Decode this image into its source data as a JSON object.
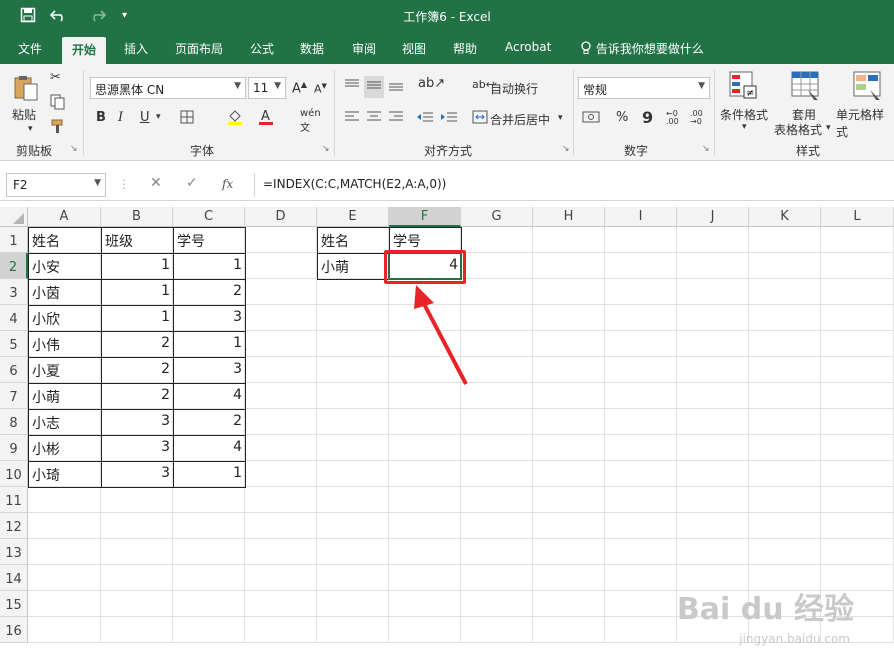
{
  "titlebar": {
    "title": "工作簿6  -  Excel",
    "save_icon": "save-icon",
    "undo_icon": "undo-icon",
    "redo_icon": "redo-icon"
  },
  "tabs": [
    "文件",
    "开始",
    "插入",
    "页面布局",
    "公式",
    "数据",
    "审阅",
    "视图",
    "帮助",
    "Acrobat"
  ],
  "active_tab": "开始",
  "tell_me": "告诉我你想要做什么",
  "ribbon": {
    "clipboard": {
      "paste": "粘贴",
      "label": "剪贴板"
    },
    "font": {
      "name": "思源黑体 CN",
      "size": "11",
      "bold": "B",
      "italic": "I",
      "underline": "U",
      "label": "字体"
    },
    "alignment": {
      "wrap": "自动换行",
      "merge": "合并后居中",
      "label": "对齐方式"
    },
    "number": {
      "format": "常规",
      "percent": "%",
      "comma": "9",
      "label": "数字"
    },
    "styles": {
      "conditional": "条件格式",
      "table1": "套用",
      "table2": "表格格式",
      "cell_styles": "单元格样式",
      "label": "样式"
    }
  },
  "formula_bar": {
    "name_box": "F2",
    "fx": "fx",
    "formula": "=INDEX(C:C,MATCH(E2,A:A,0))"
  },
  "columns": [
    "A",
    "B",
    "C",
    "D",
    "E",
    "F",
    "G",
    "H",
    "I",
    "J",
    "K",
    "L"
  ],
  "rows": [
    "1",
    "2",
    "3",
    "4",
    "5",
    "6",
    "7",
    "8",
    "9",
    "10",
    "11",
    "12",
    "13",
    "14",
    "15",
    "16"
  ],
  "table_headers": [
    "姓名",
    "班级",
    "学号"
  ],
  "table_rows": [
    [
      "小安",
      "1",
      "1"
    ],
    [
      "小茵",
      "1",
      "2"
    ],
    [
      "小欣",
      "1",
      "3"
    ],
    [
      "小伟",
      "2",
      "1"
    ],
    [
      "小夏",
      "2",
      "3"
    ],
    [
      "小萌",
      "2",
      "4"
    ],
    [
      "小志",
      "3",
      "2"
    ],
    [
      "小彬",
      "3",
      "4"
    ],
    [
      "小琦",
      "3",
      "1"
    ]
  ],
  "lookup": {
    "header_e": "姓名",
    "header_f": "学号",
    "value_e": "小萌",
    "value_f": "4"
  },
  "selected_cell": "F2",
  "highlight_color": "#e8232a",
  "accent": "#217346",
  "watermark": {
    "main": "Bai du 经验",
    "sub": "jingyan.baidu.com"
  }
}
